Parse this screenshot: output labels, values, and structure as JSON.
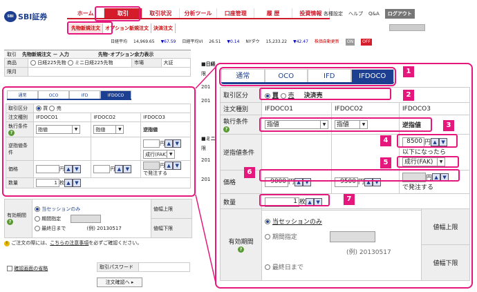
{
  "logo": {
    "mark": "SBI",
    "name": "SBI証券"
  },
  "nav": {
    "items": [
      "ホーム",
      "取引",
      "取引状況",
      "分析ツール",
      "口座管理",
      "履 歴",
      "投資情報"
    ],
    "active": 1
  },
  "rlinks": {
    "settings": "各種設定",
    "help": "ヘルプ",
    "qa": "Q&A",
    "logout": "ログアウト"
  },
  "subnav": {
    "futures_new": "先物新規注文",
    "options_new": "オプション新規注文",
    "settlement": "決済注文"
  },
  "ticker": {
    "nikkei_label": "日経平均",
    "nikkei_value": "14,969.65",
    "nikkei_change": "▼67.59",
    "vi_label": "日経平均VI",
    "vi_value": "26.51",
    "vi_change": "▼0.14",
    "ny_label": "NYダウ",
    "ny_value": "15,233.22",
    "ny_change": "▼42.47",
    "auto_label": "株価自動更新",
    "on": "ON",
    "off": "OFF"
  },
  "left": {
    "header": {
      "section": "取引",
      "title": "先物新規注文 － 入力",
      "margin_link": "先物･オプション余力表示"
    },
    "product_label": "商品",
    "product_opt1": "日経225先物",
    "product_opt2": "ミニ日経225先物",
    "market_label": "市場",
    "market_value": "大証",
    "month_label": "限月",
    "tabs": [
      "通常",
      "OCO",
      "IFD",
      "IFDOCO"
    ],
    "trade_type_label": "取引区分",
    "buy": "買",
    "sell": "売",
    "order_type_label": "注文種別",
    "orders": [
      "IFDOCO1",
      "IFDOCO2",
      "IFDOCO3"
    ],
    "cond_label": "執行条件",
    "limit": "指値",
    "stop_label": "逆指値",
    "stop_cond_label": "逆指値条件",
    "yen": "円",
    "market_fak": "成行(FAK)",
    "price_label": "価格",
    "order_send": "で発注する",
    "qty_label": "数量",
    "qty_value": "1",
    "unit": "枚",
    "validity_label": "有効期間",
    "v_session": "当セッションのみ",
    "v_date": "期間指定",
    "v_last": "最終日まで",
    "example": "(例) 20130517",
    "upper_limit": "値幅上限",
    "lower_limit": "値幅下限",
    "notice": "ご注文の際には、",
    "notice_link": "こちらの注意事項",
    "notice_end": "を必ずご確認ください。",
    "skip_confirm": "確認画面の省略",
    "password_label": "取引パスワード",
    "confirm_btn": "注文確認へ ▸"
  },
  "mid": {
    "label1": "■日経",
    "label2": "■ミニ",
    "c1": "限",
    "c2": "201",
    "c3": "201",
    "c4": "限",
    "c5": "201",
    "c6": "201"
  },
  "right": {
    "tabs": [
      "通常",
      "OCO",
      "IFD",
      "IFDOCO"
    ],
    "trade_type_label": "取引区分",
    "buy": "買",
    "sell": "売",
    "settle": "決済売",
    "order_type_label": "注文種別",
    "orders": [
      "IFDOCO1",
      "IFDOCO2",
      "IFDOCO3"
    ],
    "cond_label": "執行条件",
    "limit": "指値",
    "stop_label": "逆指値",
    "stop_cond_label": "逆指値条件",
    "stop_price": "8500",
    "yen": "円",
    "below": "以下になったら",
    "market_fak": "成行(FAK)",
    "price_label": "価格",
    "price1": "9000",
    "price2": "9500",
    "order_send": "で発注する",
    "qty_label": "数量",
    "qty_value": "1",
    "unit": "枚",
    "validity_label": "有効期間",
    "v_session": "当セッションのみ",
    "v_date": "期間指定",
    "v_last": "最終日まで",
    "example": "(例) 20130517",
    "upper_limit": "値幅上限",
    "lower_limit": "値幅下限"
  },
  "badges": [
    "1",
    "2",
    "3",
    "4",
    "5",
    "6",
    "7"
  ]
}
